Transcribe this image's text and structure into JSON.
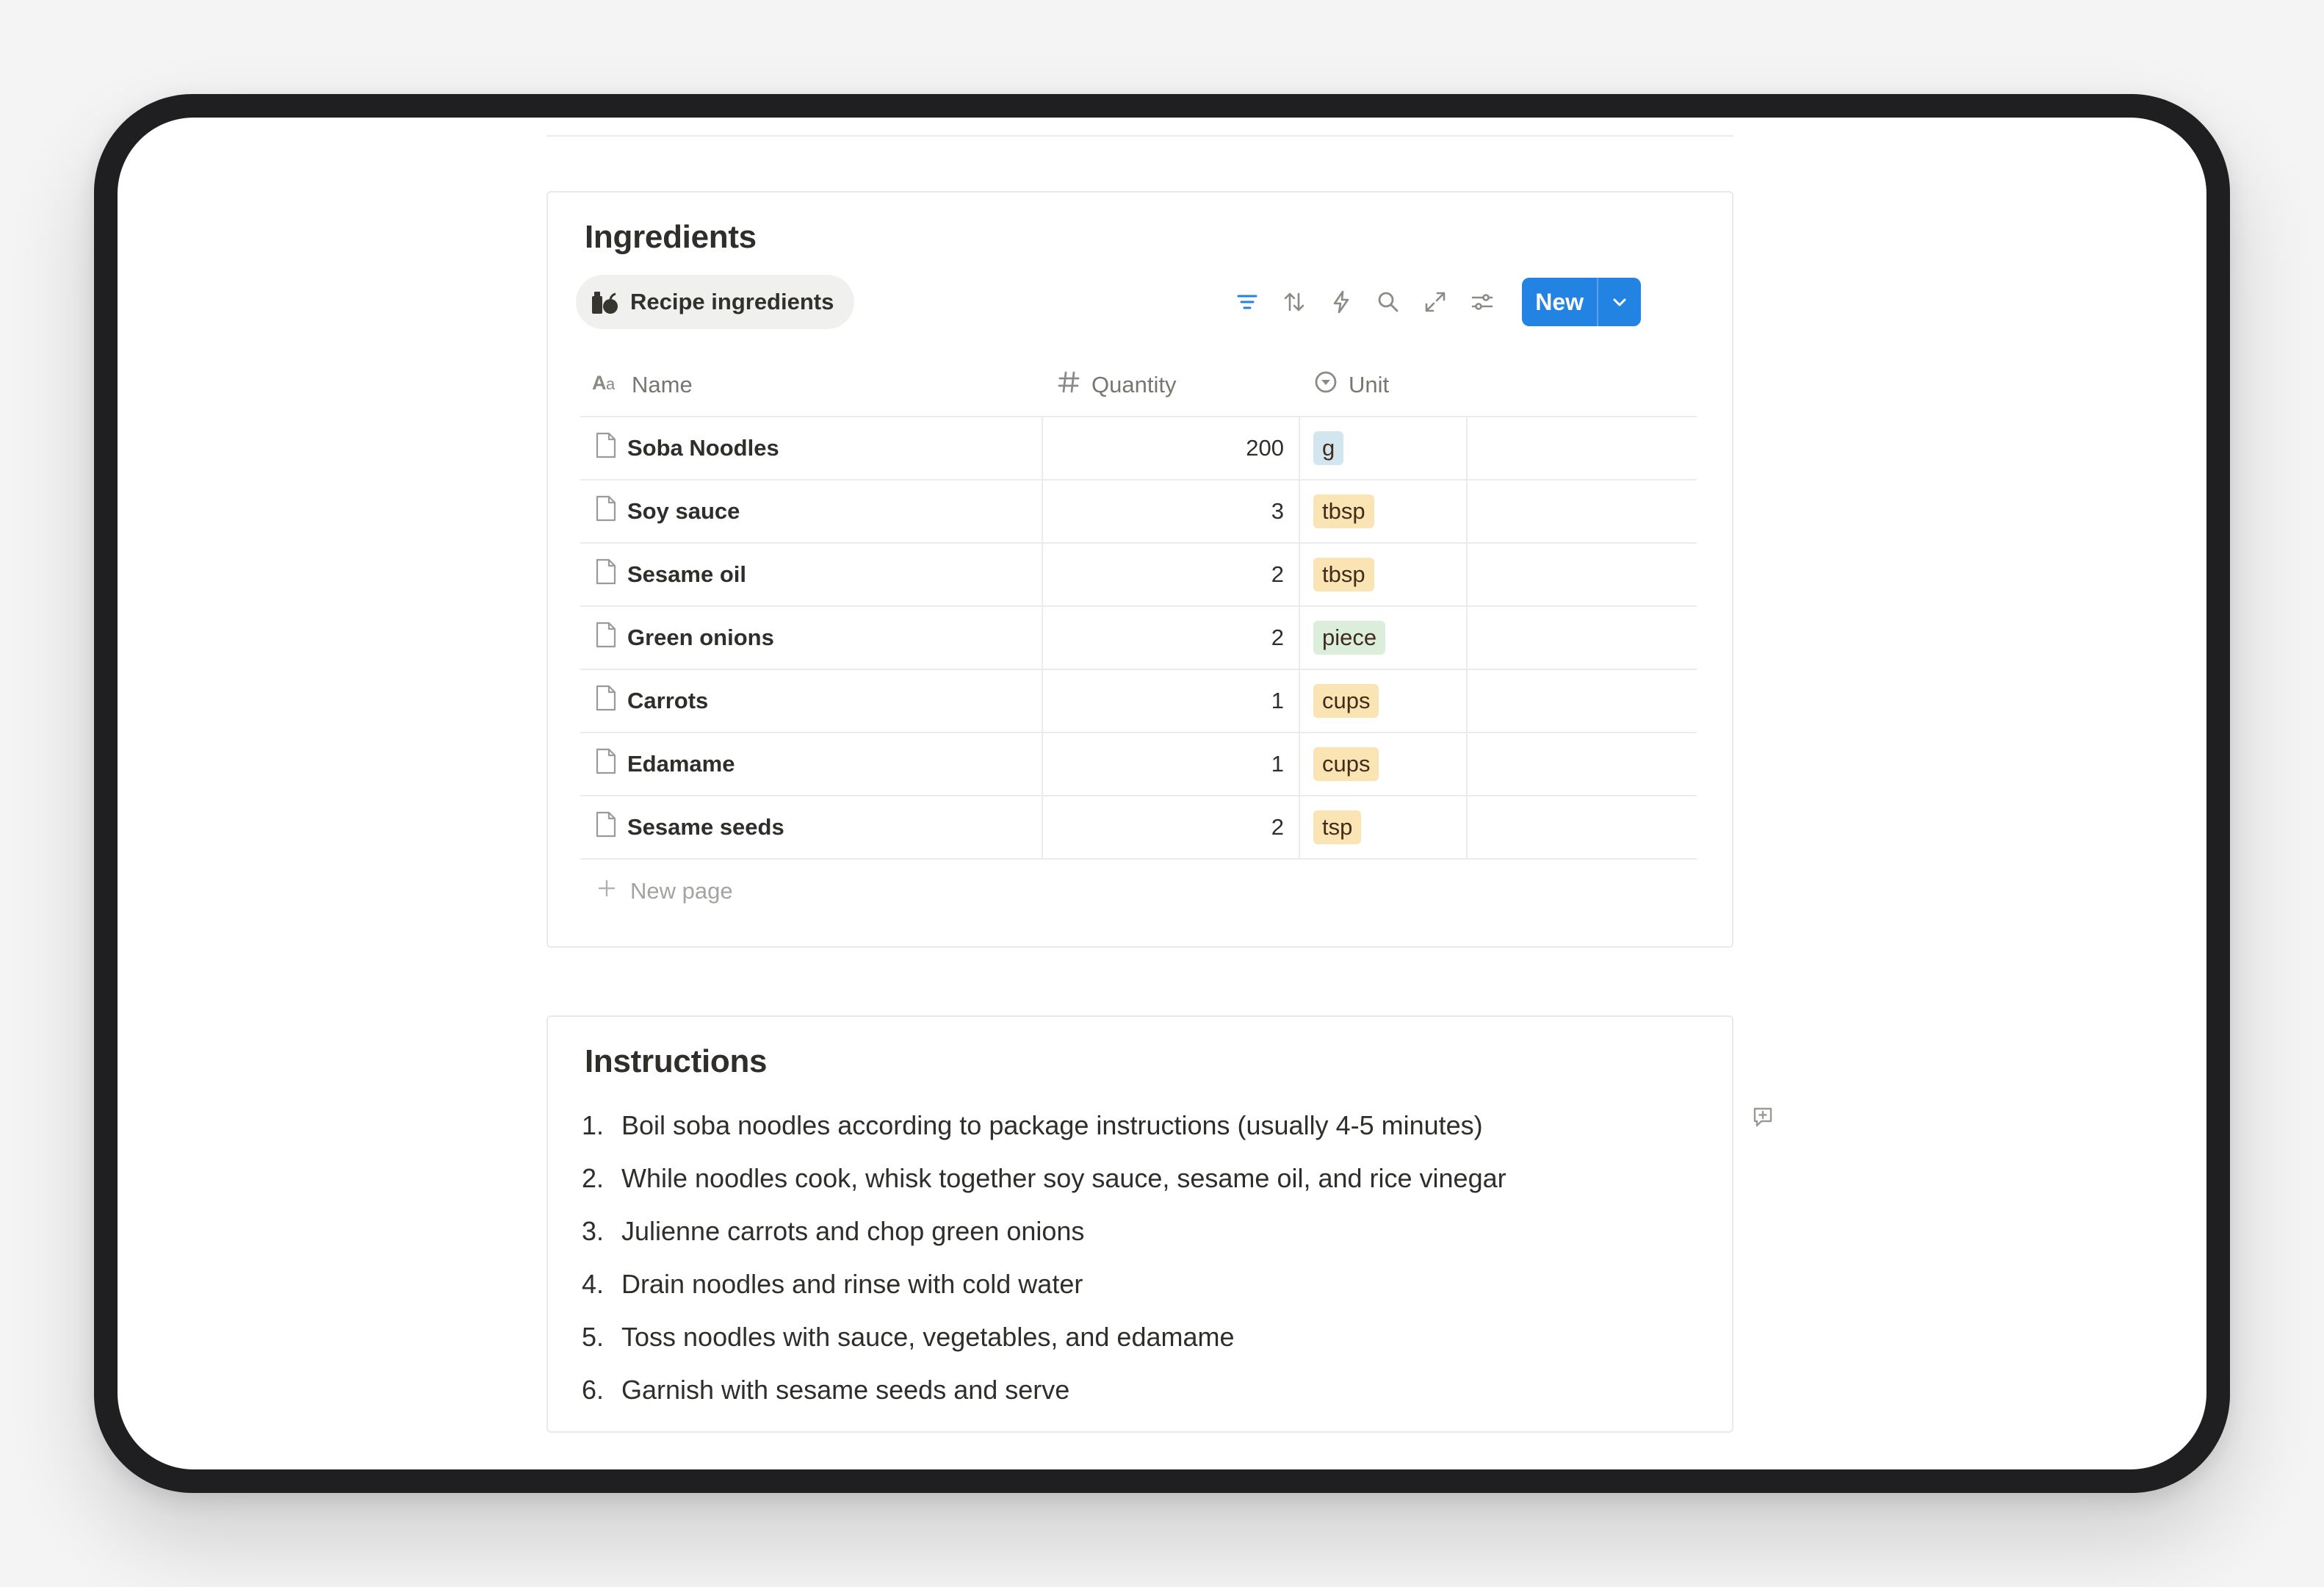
{
  "ingredients_section": {
    "title": "Ingredients",
    "view_tab": {
      "label": "Recipe ingredients",
      "icon": "groceries-icon"
    },
    "toolbar": {
      "icons": [
        "filter-icon",
        "sort-icon",
        "automation-icon",
        "search-icon",
        "expand-icon",
        "settings-icon"
      ],
      "new_button_label": "New",
      "accent_color": "#2383e2"
    },
    "columns": [
      {
        "label": "Name",
        "icon": "text-type-icon"
      },
      {
        "label": "Quantity",
        "icon": "number-type-icon"
      },
      {
        "label": "Unit",
        "icon": "select-type-icon"
      }
    ],
    "rows": [
      {
        "name": "Soba Noodles",
        "quantity": "200",
        "unit": "g",
        "unit_color": "#d3e5ef"
      },
      {
        "name": "Soy sauce",
        "quantity": "3",
        "unit": "tbsp",
        "unit_color": "#fbe4b4"
      },
      {
        "name": "Sesame oil",
        "quantity": "2",
        "unit": "tbsp",
        "unit_color": "#fbe4b4"
      },
      {
        "name": "Green onions",
        "quantity": "2",
        "unit": "piece",
        "unit_color": "#dbeddb"
      },
      {
        "name": "Carrots",
        "quantity": "1",
        "unit": "cups",
        "unit_color": "#fbe4b4"
      },
      {
        "name": "Edamame",
        "quantity": "1",
        "unit": "cups",
        "unit_color": "#fbe4b4"
      },
      {
        "name": "Sesame seeds",
        "quantity": "2",
        "unit": "tsp",
        "unit_color": "#fbe4b4"
      }
    ],
    "new_page_label": "New page"
  },
  "instructions_section": {
    "title": "Instructions",
    "steps": [
      {
        "num": "1.",
        "text": "Boil soba noodles according to package instructions (usually 4-5 minutes)"
      },
      {
        "num": "2.",
        "text": "While noodles cook, whisk together soy sauce, sesame oil, and rice vinegar"
      },
      {
        "num": "3.",
        "text": "Julienne carrots and chop green onions"
      },
      {
        "num": "4.",
        "text": "Drain noodles and rinse with cold water"
      },
      {
        "num": "5.",
        "text": "Toss noodles with sauce, vegetables, and edamame"
      },
      {
        "num": "6.",
        "text": "Garnish with sesame seeds and serve"
      }
    ]
  },
  "side_actions": {
    "comment_icon": "add-comment-icon"
  }
}
